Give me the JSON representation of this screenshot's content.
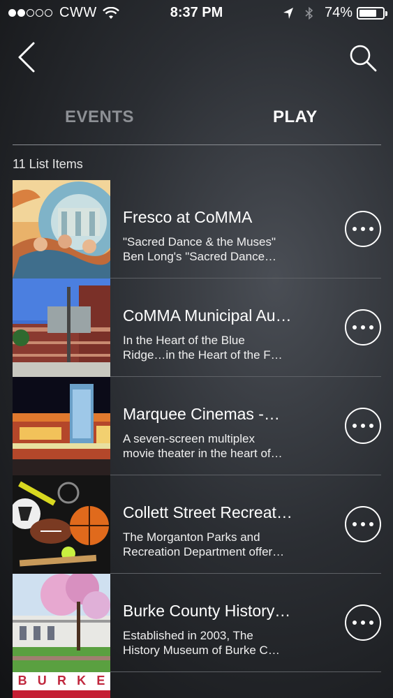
{
  "status_bar": {
    "carrier": "CWW",
    "time": "8:37 PM",
    "battery": "74%",
    "battery_level": 0.74
  },
  "header": {
    "back_icon": "chevron-left-icon",
    "search_icon": "search-icon"
  },
  "tabs": [
    {
      "label": "EVENTS",
      "active": false
    },
    {
      "label": "PLAY",
      "active": true
    }
  ],
  "list": {
    "count_label": "11 List Items",
    "items": [
      {
        "title": "Fresco at CoMMA",
        "desc1": "\"Sacred Dance & the Muses\"",
        "desc2": "Ben Long's \"Sacred Dance…"
      },
      {
        "title": "CoMMA Municipal Au…",
        "desc1": "In the Heart of the Blue",
        "desc2": "Ridge…in the Heart of the F…"
      },
      {
        "title": "Marquee Cinemas -…",
        "desc1": "A seven-screen multiplex",
        "desc2": "movie theater in the heart of…"
      },
      {
        "title": "Collett Street Recreat…",
        "desc1": "The Morganton Parks and",
        "desc2": "Recreation Department offer…"
      },
      {
        "title": "Burke County History…",
        "desc1": "Established in 2003, The",
        "desc2": "History Museum of Burke C…"
      }
    ],
    "partial_item_text": "BURKE"
  }
}
